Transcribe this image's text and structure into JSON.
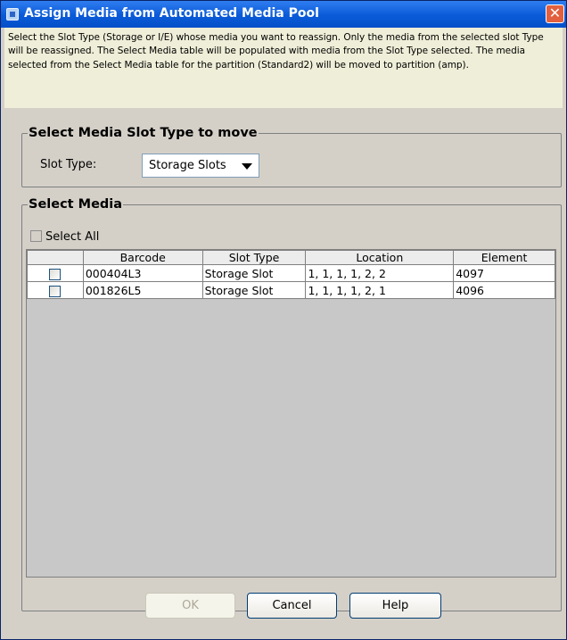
{
  "window": {
    "title": "Assign Media from Automated Media Pool",
    "close_glyph": "✕"
  },
  "description": "Select the Slot Type (Storage or I/E) whose media you want to reassign. Only the media from the selected slot Type will be reassigned. The Select Media table will be populated with media from the Slot Type selected. The media selected from the Select Media table for the partition (Standard2) will be moved to partition (amp).",
  "slot_section": {
    "legend": "Select Media Slot Type to move",
    "label": "Slot Type:",
    "selected": "Storage Slots"
  },
  "media_section": {
    "legend": "Select Media",
    "select_all_label": "Select All",
    "columns": [
      "",
      "Barcode",
      "Slot Type",
      "Location",
      "Element"
    ],
    "rows": [
      {
        "checked": false,
        "barcode": "000404L3",
        "slot_type": "Storage Slot",
        "location": "1, 1, 1, 1, 2, 2",
        "element": "4097"
      },
      {
        "checked": false,
        "barcode": "001826L5",
        "slot_type": "Storage Slot",
        "location": "1, 1, 1, 1, 2, 1",
        "element": "4096"
      }
    ]
  },
  "buttons": {
    "ok": "OK",
    "cancel": "Cancel",
    "help": "Help"
  },
  "icons": {
    "title_icon": "app-window-icon",
    "close_icon": "close-icon",
    "dropdown_icon": "chevron-down-icon"
  },
  "colors": {
    "titlebar": "#0a5ad8",
    "description_bg": "#efeed8",
    "panel_bg": "#d4d0c8",
    "close_button": "#e2603f"
  }
}
